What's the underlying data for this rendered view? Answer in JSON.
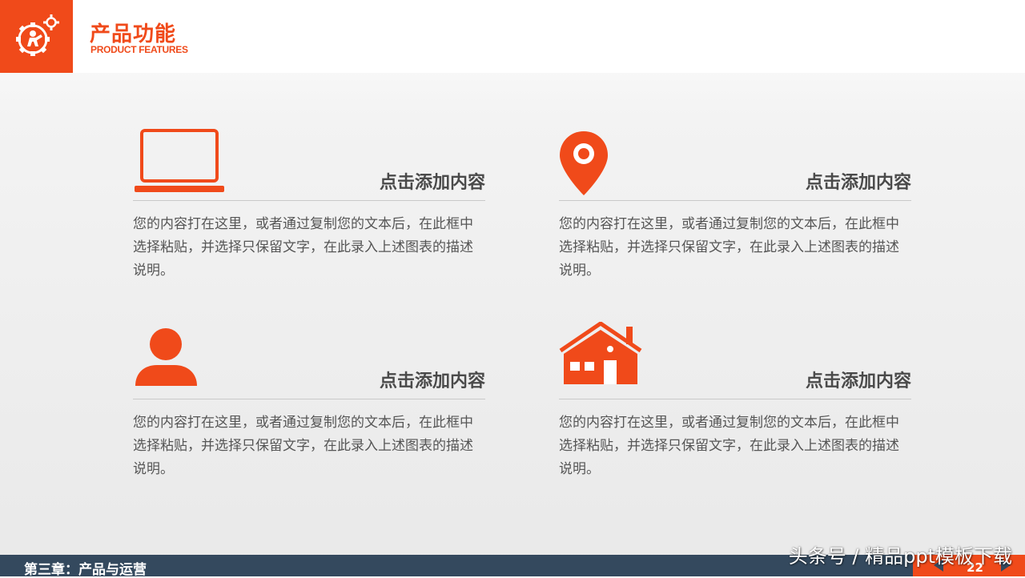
{
  "header": {
    "title_cn": "产品功能",
    "title_en": "PRODUCT FEATURES",
    "logo_icon": "gear-person-icon"
  },
  "accent_color": "#f04a1a",
  "footer_color": "#34495e",
  "features": [
    {
      "icon": "laptop-icon",
      "heading": "点击添加内容",
      "body": "您的内容打在这里，或者通过复制您的文本后，在此框中选择粘贴，并选择只保留文字，在此录入上述图表的描述说明。"
    },
    {
      "icon": "location-pin-icon",
      "heading": "点击添加内容",
      "body": "您的内容打在这里，或者通过复制您的文本后，在此框中选择粘贴，并选择只保留文字，在此录入上述图表的描述说明。"
    },
    {
      "icon": "user-icon",
      "heading": "点击添加内容",
      "body": "您的内容打在这里，或者通过复制您的文本后，在此框中选择粘贴，并选择只保留文字，在此录入上述图表的描述说明。"
    },
    {
      "icon": "house-icon",
      "heading": "点击添加内容",
      "body": "您的内容打在这里，或者通过复制您的文本后，在此框中选择粘贴，并选择只保留文字，在此录入上述图表的描述说明。"
    }
  ],
  "footer": {
    "chapter": "第三章：产品与运营",
    "page_number": "22"
  },
  "watermark": "头条号 / 精品ppt模板下载"
}
